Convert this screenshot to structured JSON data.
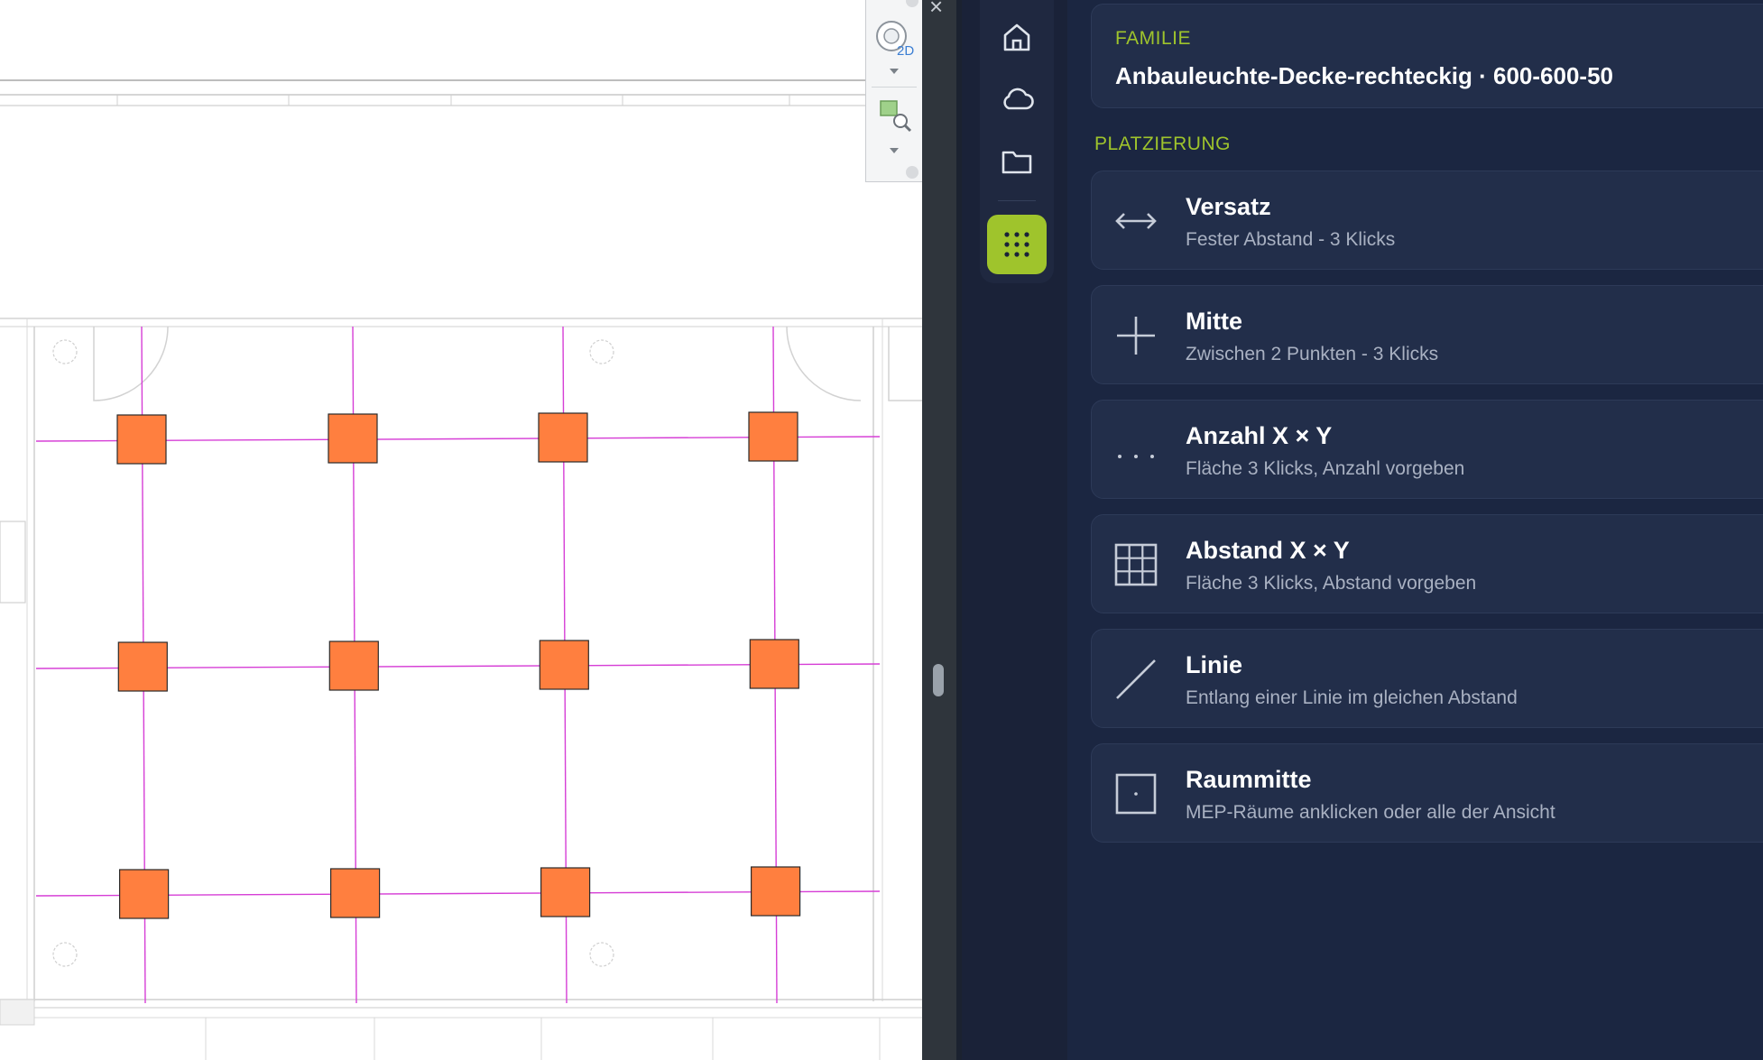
{
  "panel": {
    "family": {
      "label": "FAMILIE",
      "value": "Anbauleuchte-Decke-rechteckig · 600-600-50"
    },
    "placement_label": "PLATZIERUNG",
    "options": [
      {
        "id": "versatz",
        "title": "Versatz",
        "subtitle": "Fester Abstand - 3 Klicks",
        "icon": "arrows-horizontal-icon"
      },
      {
        "id": "mitte",
        "title": "Mitte",
        "subtitle": "Zwischen 2 Punkten - 3 Klicks",
        "icon": "plus-icon"
      },
      {
        "id": "anzahl",
        "title": "Anzahl X × Y",
        "subtitle": "Fläche 3 Klicks, Anzahl vorgeben",
        "icon": "dots-icon"
      },
      {
        "id": "abstand",
        "title": "Abstand X × Y",
        "subtitle": "Fläche 3 Klicks, Abstand vorgeben",
        "icon": "grid-icon"
      },
      {
        "id": "linie",
        "title": "Linie",
        "subtitle": "Entlang einer Linie im gleichen Abstand",
        "icon": "diagonal-line-icon"
      },
      {
        "id": "raummitte",
        "title": "Raummitte",
        "subtitle": "MEP-Räume anklicken oder alle der Ansicht",
        "icon": "square-dot-icon"
      }
    ]
  },
  "rail": {
    "items": [
      {
        "icon": "home-icon"
      },
      {
        "icon": "cloud-icon"
      },
      {
        "icon": "folder-icon"
      },
      {
        "icon": "grid-dots-icon",
        "active": true
      }
    ]
  },
  "navbar": {
    "view_badge": "2D"
  },
  "colors": {
    "accent": "#9fc42c",
    "panel_bg": "#1b2641",
    "card_bg": "#222e4a",
    "fixture": "#ff7f3f",
    "grid_line": "#d63ed6"
  }
}
